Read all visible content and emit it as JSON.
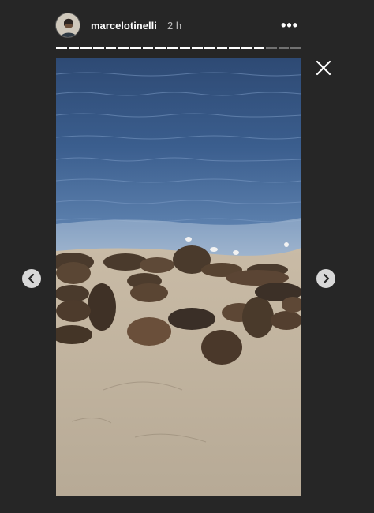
{
  "header": {
    "username": "marcelotinelli",
    "time": "2 h",
    "more_icon": "more-horizontal-icon"
  },
  "progress": {
    "segments_total": 20,
    "segments_viewed": 17
  },
  "story": {
    "image_subject": "sea-lions-on-beach-photo"
  },
  "controls": {
    "close_icon": "close-icon",
    "prev_icon": "chevron-left-icon",
    "next_icon": "chevron-right-icon"
  },
  "colors": {
    "background": "#262626",
    "progress_active": "#ffffff",
    "progress_inactive": "rgba(255,255,255,0.35)"
  }
}
